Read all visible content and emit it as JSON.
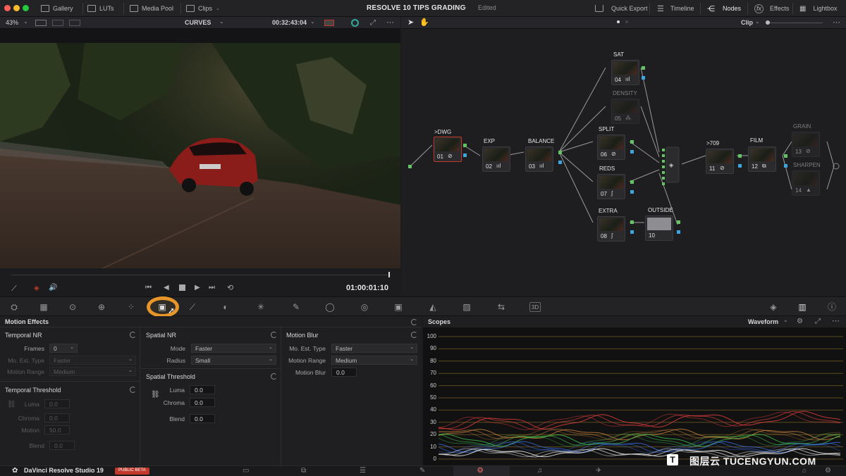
{
  "topbar": {
    "tabs": [
      {
        "label": "Gallery",
        "icon": "gallery-icon"
      },
      {
        "label": "LUTs",
        "icon": "luts-icon"
      },
      {
        "label": "Media Pool",
        "icon": "media-pool-icon"
      },
      {
        "label": "Clips",
        "icon": "clips-icon"
      }
    ],
    "project_title": "RESOLVE 10 TIPS GRADING",
    "project_state": "Edited",
    "right_tabs": [
      {
        "label": "Quick Export",
        "icon": "quick-export-icon"
      },
      {
        "label": "Timeline",
        "icon": "timeline-icon"
      },
      {
        "label": "Nodes",
        "icon": "nodes-icon"
      },
      {
        "label": "Effects",
        "icon": "effects-icon"
      },
      {
        "label": "Lightbox",
        "icon": "lightbox-icon"
      }
    ]
  },
  "viewer": {
    "zoom": "43%",
    "mode": "CURVES",
    "timecode": "00:32:43:04",
    "playhead_timecode": "01:00:01:10"
  },
  "node_editor": {
    "mode": "Clip",
    "nodes": [
      {
        "id": "01",
        "label": ">DWG"
      },
      {
        "id": "02",
        "label": "EXP"
      },
      {
        "id": "03",
        "label": "BALANCE"
      },
      {
        "id": "04",
        "label": "SAT"
      },
      {
        "id": "05",
        "label": "DENSITY"
      },
      {
        "id": "06",
        "label": "SPLIT"
      },
      {
        "id": "07",
        "label": "REDS"
      },
      {
        "id": "08",
        "label": "EXTRA"
      },
      {
        "id": "10",
        "label": "OUTSIDE"
      },
      {
        "id": "11",
        "label": ">709"
      },
      {
        "id": "12",
        "label": "FILM"
      },
      {
        "id": "13",
        "label": "GRAIN"
      },
      {
        "id": "14",
        "label": "SHARPEN"
      }
    ]
  },
  "motion_effects": {
    "title": "Motion Effects",
    "temporal_nr": {
      "title": "Temporal NR",
      "frames_label": "Frames",
      "frames_value": "0",
      "mo_est_label": "Mo. Est. Type",
      "mo_est_value": "Faster",
      "motion_range_label": "Motion Range",
      "motion_range_value": "Medium"
    },
    "temporal_threshold": {
      "title": "Temporal Threshold",
      "luma_label": "Luma",
      "luma_value": "0.0",
      "chroma_label": "Chroma",
      "chroma_value": "0.0",
      "motion_label": "Motion",
      "motion_value": "50.0",
      "blend_label": "Blend",
      "blend_value": "0.0"
    },
    "spatial_nr": {
      "title": "Spatial NR",
      "mode_label": "Mode",
      "mode_value": "Faster",
      "radius_label": "Radius",
      "radius_value": "Small"
    },
    "spatial_threshold": {
      "title": "Spatial Threshold",
      "luma_label": "Luma",
      "luma_value": "0.0",
      "chroma_label": "Chroma",
      "chroma_value": "0.0",
      "blend_label": "Blend",
      "blend_value": "0.0"
    },
    "motion_blur": {
      "title": "Motion Blur",
      "mo_est_label": "Mo. Est. Type",
      "mo_est_value": "Faster",
      "motion_range_label": "Motion Range",
      "motion_range_value": "Medium",
      "motion_blur_label": "Motion Blur",
      "motion_blur_value": "0.0"
    }
  },
  "scopes": {
    "title": "Scopes",
    "type": "Waveform",
    "scale": [
      "100",
      "90",
      "80",
      "70",
      "60",
      "50",
      "40",
      "30",
      "20",
      "10",
      "0"
    ]
  },
  "bottombar": {
    "app_name": "DaVinci Resolve Studio 19",
    "badge": "PUBLIC BETA"
  },
  "watermark": "图层云 TUCENGYUN.COM",
  "colors": {
    "accent": "#e8962a",
    "badge": "#c0392b"
  }
}
